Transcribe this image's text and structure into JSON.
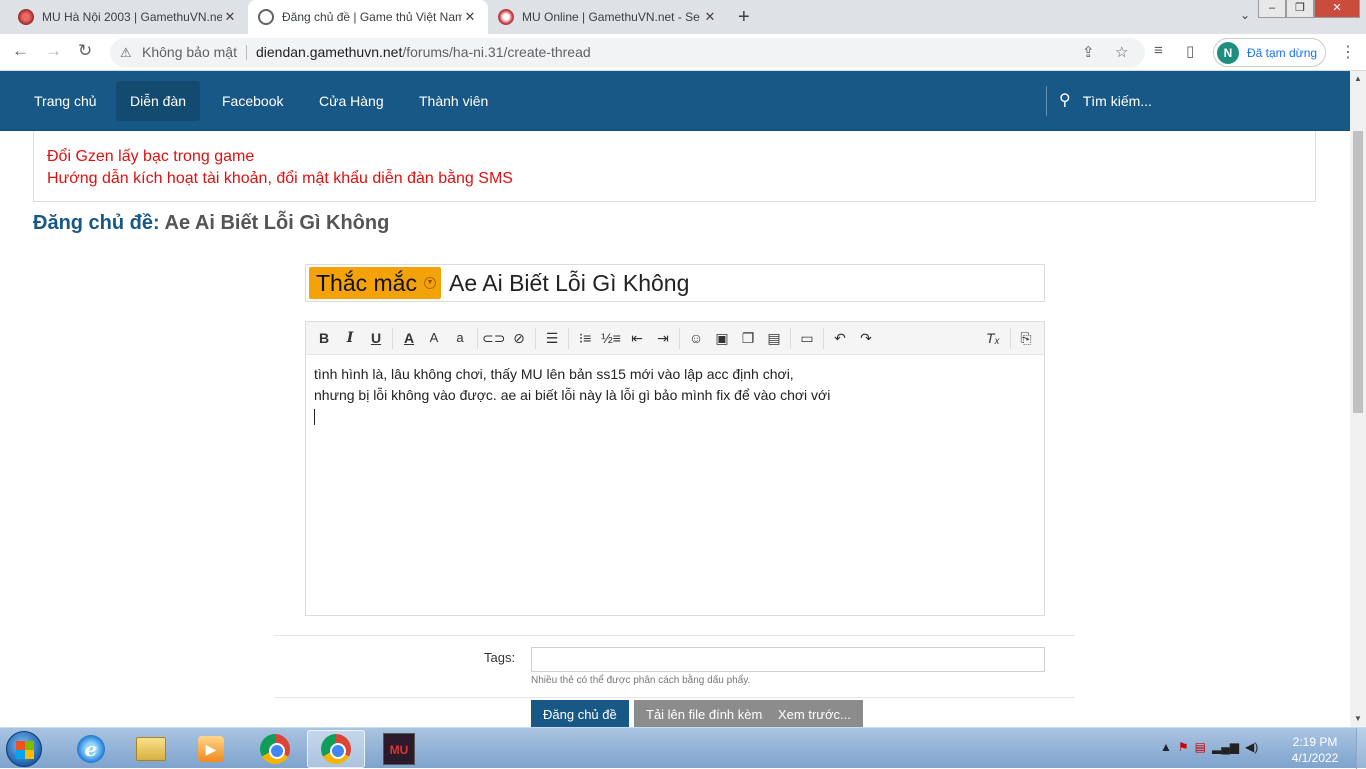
{
  "browser": {
    "tabs": [
      {
        "title": "MU Hà Nội 2003 | GamethuVN.ne",
        "close": "✕",
        "icon": "mu-favicon"
      },
      {
        "title": "Đăng chủ đề | Game thủ Việt Nam",
        "close": "✕",
        "icon": "globe-icon"
      },
      {
        "title": "MU Online | GamethuVN.net - Se",
        "close": "✕",
        "icon": "mu-online-favicon"
      }
    ],
    "new_tab": "+",
    "tab_search": "⌄",
    "window_buttons": {
      "minimize": "–",
      "maximize": "❐",
      "close": "✕"
    },
    "nav": {
      "back": "←",
      "forward": "→",
      "reload": "↻"
    },
    "security_label": "Không bảo mật",
    "url_host": "diendan.gamethuvn.net",
    "url_path": "/forums/ha-ni.31/create-thread",
    "profile": {
      "initial": "N",
      "status": "Đã tạm dừng"
    },
    "menu": "⋮"
  },
  "site_nav": {
    "items": [
      {
        "label": "Trang chủ"
      },
      {
        "label": "Diễn đàn"
      },
      {
        "label": "Facebook"
      },
      {
        "label": "Cửa Hàng"
      },
      {
        "label": "Thành viên"
      }
    ],
    "search_label": "Tìm kiếm..."
  },
  "notice": {
    "lines": [
      "Đổi Gzen lấy bạc trong game",
      "Hướng dẫn kích hoạt tài khoản, đổi mật khẩu diễn đàn bằng SMS"
    ]
  },
  "page": {
    "title_prefix": "Đăng chủ đề:",
    "title_text": "Ae Ai Biết Lỗi Gì Không"
  },
  "thread": {
    "prefix_label": "Thắc mắc",
    "title_value": "Ae Ai Biết Lỗi Gì Không",
    "body_lines": [
      "tình hình là, lâu không chơi, thấy MU lên bản ss15 mới vào lập acc định chơi,",
      "nhưng bị lỗi không vào được. ae ai biết lỗi này là lỗi gì bảo mình fix để vào chơi với"
    ]
  },
  "toolbar": {
    "bold": "B",
    "italic": "I",
    "underline": "U",
    "font_color": "A",
    "font_size": "A",
    "font_family": "a"
  },
  "tags": {
    "label": "Tags:",
    "value": "",
    "hint": "Nhiều thẻ có thể được phân cách bằng dấu phẩy."
  },
  "buttons": {
    "submit": "Đăng chủ đề",
    "upload": "Tải lên file đính kèm",
    "preview": "Xem trước..."
  },
  "taskbar": {
    "apps": [
      "internet-explorer",
      "file-explorer",
      "media-player",
      "chrome",
      "chrome-active",
      "mu-game"
    ],
    "mu_label": "MU",
    "time": "2:19 PM",
    "date": "4/1/2022"
  },
  "colors": {
    "nav_bg": "#185886",
    "notice_text": "#e01010",
    "prefix_bg": "#f4a20a"
  }
}
